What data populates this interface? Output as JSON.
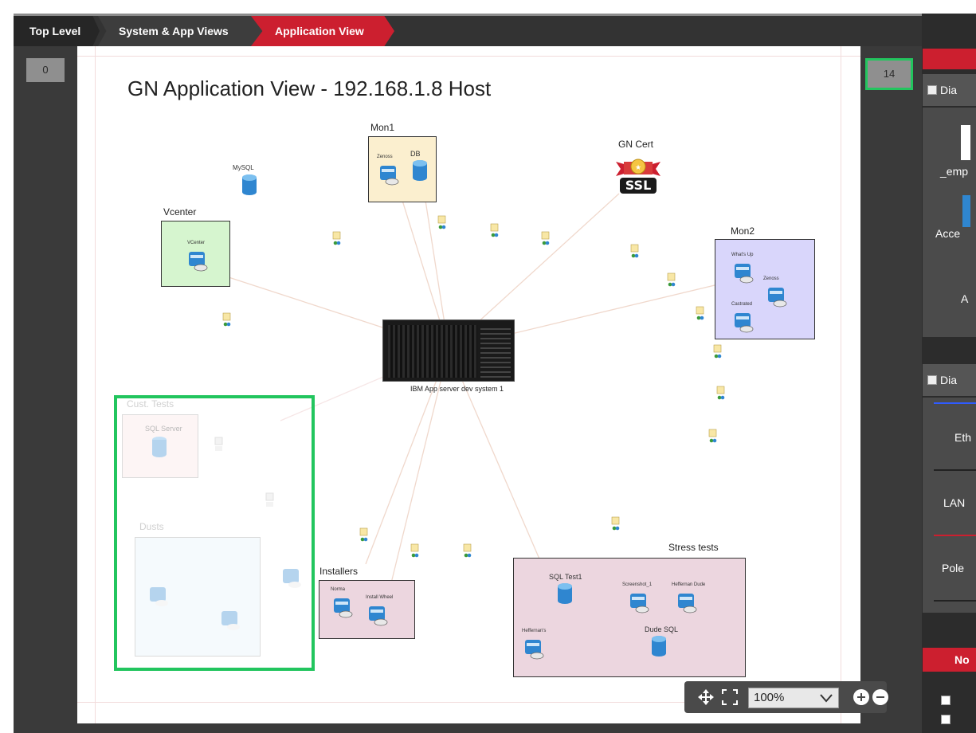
{
  "breadcrumb": {
    "items": [
      {
        "label": "Top Level"
      },
      {
        "label": "System & App Views"
      },
      {
        "label": "Application View"
      }
    ]
  },
  "counters": {
    "left": "0",
    "right": "14"
  },
  "diagram": {
    "title": "GN Application View - 192.168.1.8 Host",
    "server_label": "IBM App server dev system 1",
    "nodes": {
      "mysql": "MySQL",
      "vcenter_group": "Vcenter",
      "vcenter_node": "VCenter",
      "mon1_group": "Mon1",
      "mon1_node_a": "Zenoss",
      "mon1_db": "DB",
      "gn_cert": "GN Cert",
      "ssl_text": "SSL",
      "mon2_group": "Mon2",
      "mon2_node_a": "What's Up",
      "mon2_node_b": "Zenoss",
      "mon2_node_c": "Castrated",
      "cust_tests_group": "Cust. Tests",
      "sql_server": "SQL Server",
      "dusts_group": "Dusts",
      "installers_group": "Installers",
      "installer_a": "Norma",
      "installer_b": "Install Wheel",
      "stress_group": "Stress tests",
      "sql_test1": "SQL Test1",
      "stress_a": "Screenshot_1",
      "stress_b": "Heffernan Dude",
      "stress_c": "Heffernan's",
      "dude_sql": "Dude SQL"
    }
  },
  "zoom": {
    "level": "100%"
  },
  "side_panel": {
    "section1_label": "Dia",
    "text_emp": "_emp",
    "text_acce": "Acce",
    "text_a": "A",
    "section2_label": "Dia",
    "text_eth": "Eth",
    "text_lan": "LAN",
    "text_pole": "Pole",
    "section3_label": "No"
  },
  "colors": {
    "accent": "#cc1f2f",
    "selection": "#22c55e",
    "mon1_fill": "#fbefcf",
    "vcenter_fill": "#d6f5cf",
    "mon2_fill": "#d9d6fb",
    "stress_fill": "#ecd6df",
    "installers_fill": "#ecd6df"
  }
}
